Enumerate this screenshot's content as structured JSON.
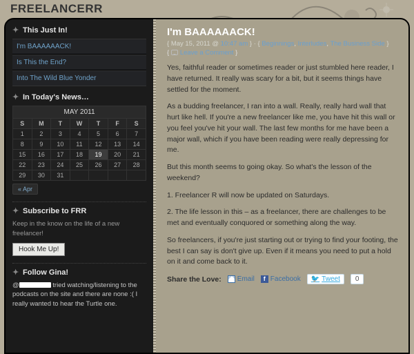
{
  "header": {
    "site_title": "FREELANCERR"
  },
  "sidebar": {
    "recent": {
      "title": "This Just In!",
      "items": [
        "I'm BAAAAAACK!",
        "Is This the End?",
        "Into The Wild Blue Yonder"
      ]
    },
    "calendar": {
      "title": "In Today's News…",
      "caption": "MAY 2011",
      "dow": [
        "S",
        "M",
        "T",
        "W",
        "T",
        "F",
        "S"
      ],
      "rows": [
        [
          "1",
          "2",
          "3",
          "4",
          "5",
          "6",
          "7"
        ],
        [
          "8",
          "9",
          "10",
          "11",
          "12",
          "13",
          "14"
        ],
        [
          "15",
          "16",
          "17",
          "18",
          "19",
          "20",
          "21"
        ],
        [
          "22",
          "23",
          "24",
          "25",
          "26",
          "27",
          "28"
        ],
        [
          "29",
          "30",
          "31",
          "",
          "",
          "",
          ""
        ]
      ],
      "today": "19",
      "prev_label": "« Apr"
    },
    "subscribe": {
      "title": "Subscribe to FRR",
      "desc": "Keep in the know on the life of a new freelancer!",
      "button": "Hook Me Up!"
    },
    "follow": {
      "title": "Follow Gina!",
      "text_prefix": "@",
      "text_rest": " tried watching/listening to the podcasts on the site and there are none :( I really wanted to hear the Turtle one."
    }
  },
  "post": {
    "title": "I'm BAAAAAACK!",
    "meta": {
      "open": "{ ",
      "date": "May 15, 2011",
      "at": " @ ",
      "time": "10:47 am",
      "sep": " }  · { ",
      "cat1": "Beginnings",
      "cat2": "Interludes",
      "cat3": "The Business Side",
      "close": " }"
    },
    "comments_label": "Leave a Comment",
    "comments_close": " }",
    "comments_open": "{ ",
    "body": {
      "p1": "Yes, faithful reader or sometimes reader or just stumbled here reader, I have returned. It really was scary for a bit, but it seems things have settled for the moment.",
      "p2": "As a budding freelancer, I ran into a wall. Really, really hard wall that hurt like hell. If you're a new freelancer like me, you have hit this wall or you feel you've hit your wall. The last few months for me have been a major wall, which if you have been reading were really depressing for me.",
      "p3": "But this month seems to going okay. So what's the lesson of the weekend?",
      "p4": "1. Freelancer R will now be updated on Saturdays.",
      "p5": "2. The life lesson in this – as a freelancer, there are challenges to be met and eventually conquored or something along the way.",
      "p6": "So freelancers, if you're just starting out or trying to find your footing, the best I can say is don't give up. Even if it means you need to put a hold on it and come back to it."
    },
    "share": {
      "label": "Share the Love:",
      "email": "Email",
      "facebook": "Facebook",
      "tweet": "Tweet",
      "tweet_count": "0"
    }
  }
}
